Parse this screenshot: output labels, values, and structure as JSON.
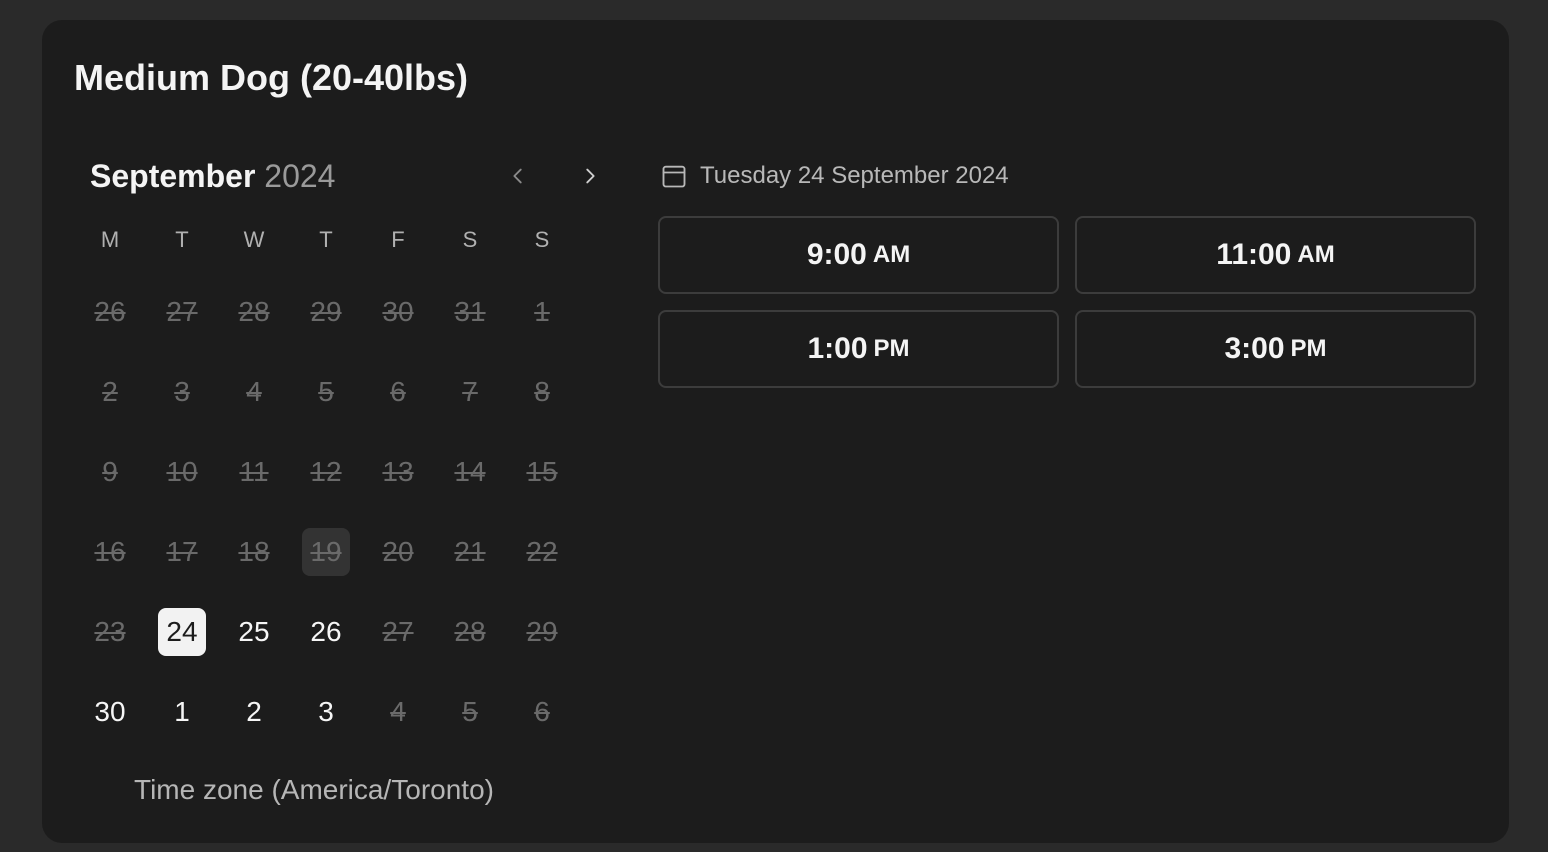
{
  "title": "Medium Dog (20-40lbs)",
  "calendar": {
    "month": "September",
    "year": "2024",
    "weekdays": [
      "M",
      "T",
      "W",
      "T",
      "F",
      "S",
      "S"
    ],
    "days": [
      {
        "label": "26",
        "state": "disabled"
      },
      {
        "label": "27",
        "state": "disabled"
      },
      {
        "label": "28",
        "state": "disabled"
      },
      {
        "label": "29",
        "state": "disabled"
      },
      {
        "label": "30",
        "state": "disabled"
      },
      {
        "label": "31",
        "state": "disabled"
      },
      {
        "label": "1",
        "state": "disabled"
      },
      {
        "label": "2",
        "state": "disabled"
      },
      {
        "label": "3",
        "state": "disabled"
      },
      {
        "label": "4",
        "state": "disabled"
      },
      {
        "label": "5",
        "state": "disabled"
      },
      {
        "label": "6",
        "state": "disabled"
      },
      {
        "label": "7",
        "state": "disabled"
      },
      {
        "label": "8",
        "state": "disabled"
      },
      {
        "label": "9",
        "state": "disabled"
      },
      {
        "label": "10",
        "state": "disabled"
      },
      {
        "label": "11",
        "state": "disabled"
      },
      {
        "label": "12",
        "state": "disabled"
      },
      {
        "label": "13",
        "state": "disabled"
      },
      {
        "label": "14",
        "state": "disabled"
      },
      {
        "label": "15",
        "state": "disabled"
      },
      {
        "label": "16",
        "state": "disabled"
      },
      {
        "label": "17",
        "state": "disabled"
      },
      {
        "label": "18",
        "state": "disabled"
      },
      {
        "label": "19",
        "state": "disabled-today"
      },
      {
        "label": "20",
        "state": "disabled"
      },
      {
        "label": "21",
        "state": "disabled"
      },
      {
        "label": "22",
        "state": "disabled"
      },
      {
        "label": "23",
        "state": "disabled"
      },
      {
        "label": "24",
        "state": "selected"
      },
      {
        "label": "25",
        "state": "available"
      },
      {
        "label": "26",
        "state": "available"
      },
      {
        "label": "27",
        "state": "disabled"
      },
      {
        "label": "28",
        "state": "disabled"
      },
      {
        "label": "29",
        "state": "disabled"
      },
      {
        "label": "30",
        "state": "available"
      },
      {
        "label": "1",
        "state": "available"
      },
      {
        "label": "2",
        "state": "available"
      },
      {
        "label": "3",
        "state": "available"
      },
      {
        "label": "4",
        "state": "disabled"
      },
      {
        "label": "5",
        "state": "disabled"
      },
      {
        "label": "6",
        "state": "disabled"
      }
    ],
    "timezone": "Time zone (America/Toronto)"
  },
  "selected_date": {
    "icon": "calendar-icon",
    "label": "Tuesday 24 September 2024"
  },
  "time_slots": [
    {
      "time": "9:00",
      "period": "AM"
    },
    {
      "time": "11:00",
      "period": "AM"
    },
    {
      "time": "1:00",
      "period": "PM"
    },
    {
      "time": "3:00",
      "period": "PM"
    }
  ],
  "icons": {
    "prev": "chevron-left-icon",
    "next": "chevron-right-icon"
  },
  "colors": {
    "page_background": "#2a2a2a",
    "card_background": "#1c1c1c",
    "selected_day_background": "#f2f2f2",
    "today_background": "#333333",
    "disabled_text": "#6a6a6a",
    "slot_border": "#3c3c3c"
  }
}
